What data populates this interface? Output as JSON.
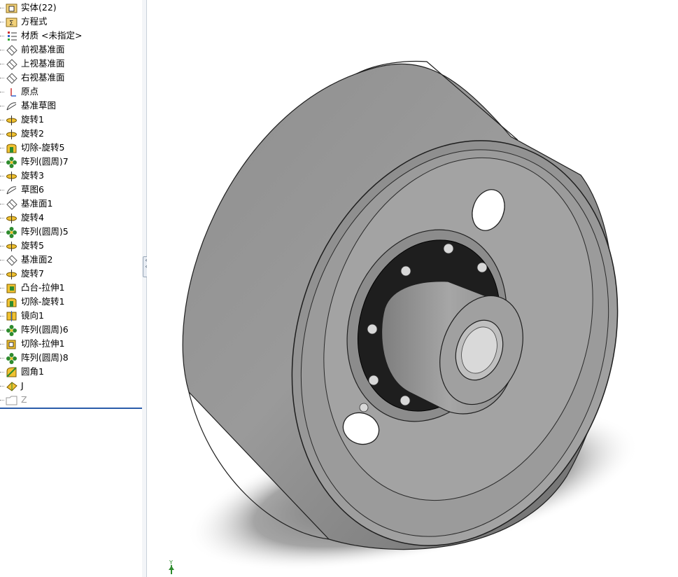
{
  "feature_tree": {
    "items": [
      {
        "label": "实体(22)",
        "icon": "solid-bodies-folder-icon"
      },
      {
        "label": "方程式",
        "icon": "equations-folder-icon"
      },
      {
        "label": "材质 <未指定>",
        "icon": "material-icon"
      },
      {
        "label": "前视基准面",
        "icon": "plane-icon"
      },
      {
        "label": "上视基准面",
        "icon": "plane-icon"
      },
      {
        "label": "右视基准面",
        "icon": "plane-icon"
      },
      {
        "label": "原点",
        "icon": "origin-icon"
      },
      {
        "label": "基准草图",
        "icon": "sketch-icon"
      },
      {
        "label": "旋转1",
        "icon": "revolve-icon"
      },
      {
        "label": "旋转2",
        "icon": "revolve-icon"
      },
      {
        "label": "切除-旋转5",
        "icon": "cut-revolve-icon"
      },
      {
        "label": "阵列(圆周)7",
        "icon": "circular-pattern-icon"
      },
      {
        "label": "旋转3",
        "icon": "revolve-icon"
      },
      {
        "label": "草图6",
        "icon": "sketch-icon"
      },
      {
        "label": "基准面1",
        "icon": "plane-icon"
      },
      {
        "label": "旋转4",
        "icon": "revolve-icon"
      },
      {
        "label": "阵列(圆周)5",
        "icon": "circular-pattern-icon"
      },
      {
        "label": "旋转5",
        "icon": "revolve-icon"
      },
      {
        "label": "基准面2",
        "icon": "plane-icon"
      },
      {
        "label": "旋转7",
        "icon": "revolve-icon"
      },
      {
        "label": "凸台-拉伸1",
        "icon": "boss-extrude-icon"
      },
      {
        "label": "切除-旋转1",
        "icon": "cut-revolve-icon"
      },
      {
        "label": "镜向1",
        "icon": "mirror-icon"
      },
      {
        "label": "阵列(圆周)6",
        "icon": "circular-pattern-icon"
      },
      {
        "label": "切除-拉伸1",
        "icon": "cut-extrude-icon"
      },
      {
        "label": "阵列(圆周)8",
        "icon": "circular-pattern-icon"
      },
      {
        "label": "圆角1",
        "icon": "fillet-icon"
      },
      {
        "label": "J",
        "icon": "part-feature-icon"
      },
      {
        "label": "Z",
        "icon": "folder-icon"
      }
    ]
  },
  "viewport": {
    "model_name": "pulley-drum-3d-model",
    "triad_label": "Y"
  },
  "colors": {
    "tree_rule": "#2a5caa",
    "drum_outer": "#8a8a8a",
    "drum_shade": "#6f6f6f",
    "flange": "#222222",
    "shaft": "#9c9c9c"
  }
}
